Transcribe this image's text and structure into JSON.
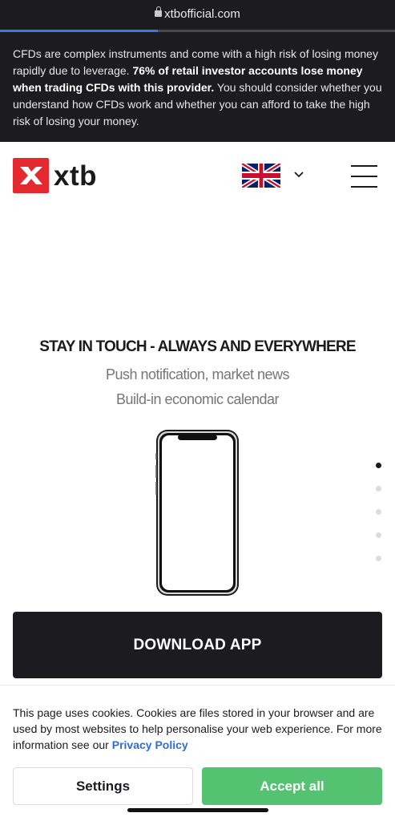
{
  "browser": {
    "url": "xtbofficial.com",
    "load_progress": 0.4
  },
  "risk_warning": {
    "part1": "CFDs are complex instruments and come with a high risk of losing money rapidly due to leverage. ",
    "bold": "76% of retail investor accounts lose money when trading CFDs with this provider.",
    "part2": " You should consider whether you understand how CFDs work and whether you can afford to take the high risk of losing your money."
  },
  "header": {
    "logo_text": "xtb",
    "language_flag": "uk-flag-icon",
    "colors": {
      "brand_red": "#e42a2f"
    }
  },
  "promo": {
    "title": "STAY IN TOUCH - ALWAYS AND EVERYWHERE",
    "line1": "Push notification, market news",
    "line2": "Build-in economic calendar",
    "slides_total": 5,
    "active_slide": 1
  },
  "download_button": {
    "label": "DOWNLOAD APP"
  },
  "cookie_banner": {
    "text": "This page uses cookies. Cookies are files stored in your browser and are used by most websites to help personalise your web experience. For more information see our ",
    "link_label": "Privacy Policy",
    "settings_label": "Settings",
    "accept_label": "Accept all",
    "colors": {
      "accept": "#54c270",
      "link": "#2e6fd6"
    }
  }
}
